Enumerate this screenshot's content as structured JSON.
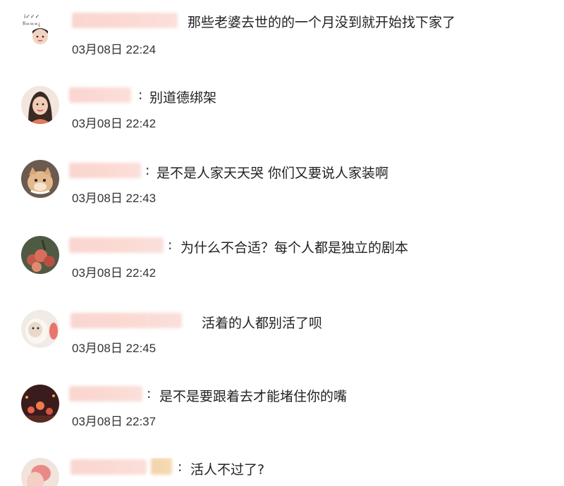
{
  "comments": [
    {
      "text": "那些老婆去世的的一个月没到就开始找下家了",
      "time": "03月08日 22:24",
      "colon": ""
    },
    {
      "text": "别道德绑架",
      "time": "03月08日 22:42",
      "colon": ":"
    },
    {
      "text": "是不是人家天天哭 你们又要说人家装啊",
      "time": "03月08日 22:43",
      "colon": ":"
    },
    {
      "text": "为什么不合适？每个人都是独立的剧本",
      "time": "03月08日 22:42",
      "colon": ":"
    },
    {
      "text": "活着的人都别活了呗",
      "time": "03月08日 22:45",
      "colon": ""
    },
    {
      "text": "是不是要跟着去才能堵住你的嘴",
      "time": "03月08日 22:37",
      "colon": ":"
    },
    {
      "text": "活人不过了?",
      "time": "",
      "colon": ":"
    }
  ],
  "colors": {
    "name_blur": "#f5b8ac",
    "text": "#222222",
    "time": "#333333"
  }
}
